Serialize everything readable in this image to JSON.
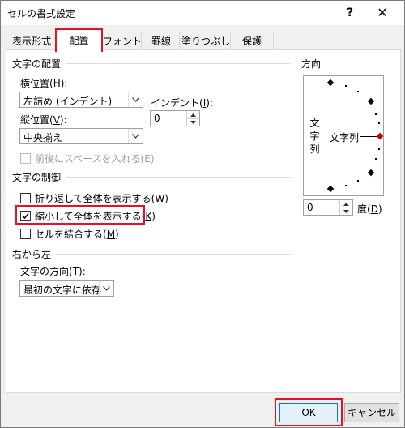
{
  "window": {
    "title": "セルの書式設定",
    "help_label": "?",
    "close_label": "✕"
  },
  "tabs": [
    {
      "label": "表示形式"
    },
    {
      "label": "配置"
    },
    {
      "label": "フォント"
    },
    {
      "label": "罫線"
    },
    {
      "label": "塗りつぶし"
    },
    {
      "label": "保護"
    }
  ],
  "alignment": {
    "section_label": "文字の配置",
    "horizontal": {
      "label": "横位置(",
      "key": "H",
      "suffix": "):",
      "value": "左詰め (インデント)"
    },
    "vertical": {
      "label": "縦位置(",
      "key": "V",
      "suffix": "):",
      "value": "中央揃え"
    },
    "indent": {
      "label": "インデント(",
      "key": "I",
      "suffix": "):",
      "value": "0"
    },
    "justify_distributed": {
      "label": "前後にスペースを入れる(E)",
      "checked": false,
      "enabled": false
    }
  },
  "text_control": {
    "section_label": "文字の制御",
    "wrap": {
      "label": "折り返して全体を表示する(",
      "key": "W",
      "suffix": ")",
      "checked": false
    },
    "shrink": {
      "label": "縮小して全体を表示する(",
      "key": "K",
      "suffix": ")",
      "checked": true
    },
    "merge": {
      "label": "セルを結合する(",
      "key": "M",
      "suffix": ")",
      "checked": false
    }
  },
  "rtl": {
    "section_label": "右から左",
    "direction": {
      "label": "文字の方向(",
      "key": "T",
      "suffix": "):",
      "value": "最初の文字に依存"
    }
  },
  "orientation": {
    "section_label": "方向",
    "vertical_text": [
      "文",
      "字",
      "列"
    ],
    "horizontal_text": "文字列",
    "degrees_value": "0",
    "degrees_label": "度(",
    "degrees_key": "D",
    "degrees_suffix": ")"
  },
  "buttons": {
    "ok": "OK",
    "cancel": "キャンセル"
  },
  "colors": {
    "highlight": "#e81123",
    "accent": "#0078d7",
    "marker": "#c00000"
  }
}
